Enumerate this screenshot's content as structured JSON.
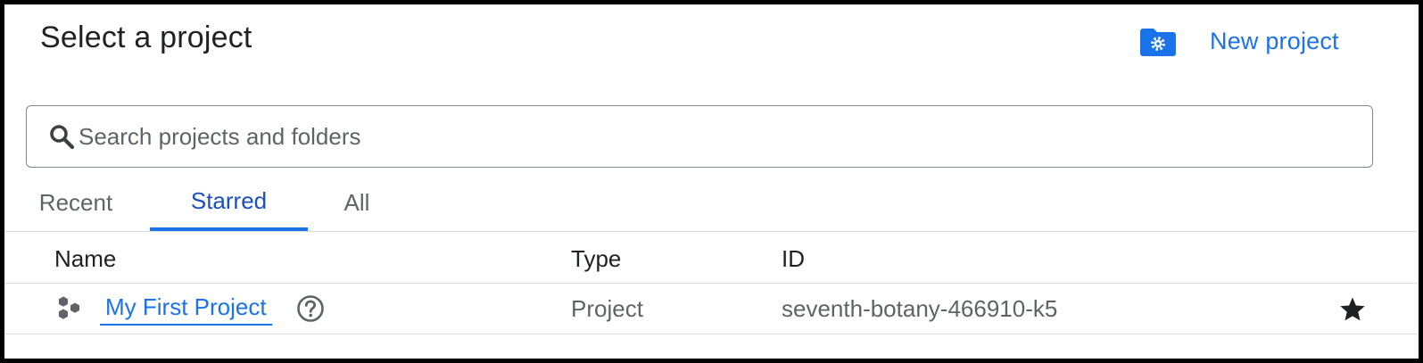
{
  "dialog": {
    "title": "Select a project",
    "new_project_label": "New project",
    "new_project_icon": "folder-settings-icon"
  },
  "search": {
    "placeholder": "Search projects and folders",
    "value": "",
    "icon": "search-icon"
  },
  "tabs": [
    {
      "label": "Recent",
      "selected": false
    },
    {
      "label": "Starred",
      "selected": true
    },
    {
      "label": "All",
      "selected": false
    }
  ],
  "table": {
    "columns": [
      "Name",
      "Type",
      "ID"
    ],
    "rows": [
      {
        "name": "My First Project",
        "type": "Project",
        "id": "seventh-botany-466910-k5",
        "starred": true,
        "icon": "project-hexagons-icon"
      }
    ]
  },
  "colors": {
    "accent": "#1a73e8",
    "selected_tab_text": "#1a4fc0",
    "text_primary": "#202124",
    "text_secondary": "#5f6368",
    "divider": "#dadce0"
  }
}
